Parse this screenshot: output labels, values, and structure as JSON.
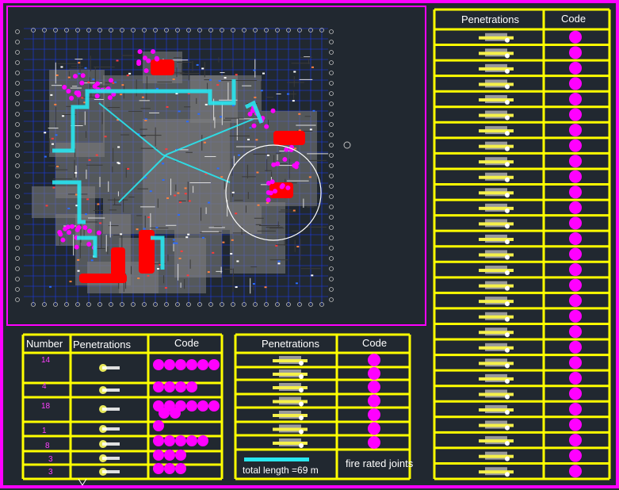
{
  "colors": {
    "background": "#212830",
    "frame": "#ff00ff",
    "table_border": "#ffff00",
    "code_dot": "#ff00ff",
    "joint_line": "#29e6ef",
    "wall": "#808080",
    "grid": "#1a3cff",
    "fire_zone": "#ff0000"
  },
  "table_left": {
    "headers": {
      "number": "Number",
      "penetrations": "Penetrations",
      "code": "Code"
    },
    "rows": [
      {
        "number": "14",
        "code_dots": 6
      },
      {
        "number": "4",
        "code_dots": 4
      },
      {
        "number": "18",
        "code_dots": 8
      },
      {
        "number": "1",
        "code_dots": 1
      },
      {
        "number": "8",
        "code_dots": 5
      },
      {
        "number": "3",
        "code_dots": 3
      },
      {
        "number": "3",
        "code_dots": 3
      }
    ]
  },
  "table_middle": {
    "headers": {
      "penetrations": "Penetrations",
      "code": "Code"
    },
    "row_count": 7,
    "legend": {
      "label": "fire rated joints",
      "total": "total length =69 m"
    }
  },
  "table_right": {
    "headers": {
      "penetrations": "Penetrations",
      "code": "Code"
    },
    "row_count": 29
  }
}
